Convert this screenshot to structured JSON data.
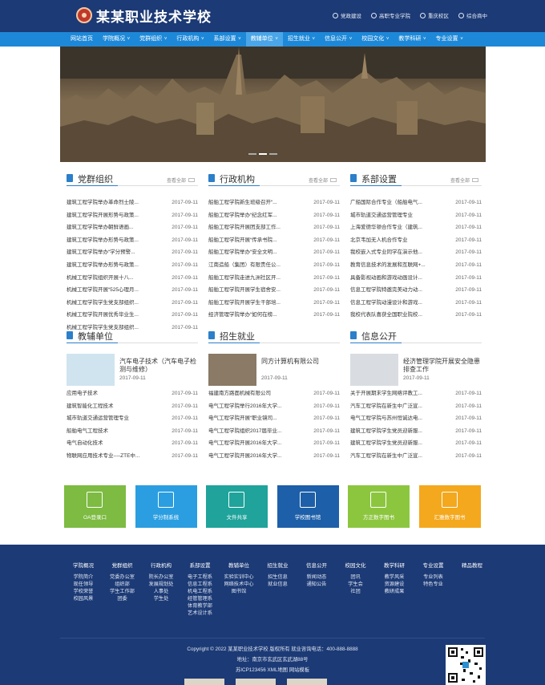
{
  "header": {
    "school_name": "某某职业技术学校",
    "quick_links": [
      "党政建设",
      "高职专业学院",
      "重庆校区",
      "综合商中"
    ]
  },
  "nav": {
    "items": [
      {
        "label": "网站首页",
        "chev": false
      },
      {
        "label": "学院概况",
        "chev": true
      },
      {
        "label": "党群组织",
        "chev": true
      },
      {
        "label": "行政机构",
        "chev": true
      },
      {
        "label": "系部设置",
        "chev": true
      },
      {
        "label": "教辅单位",
        "chev": true,
        "active": true
      },
      {
        "label": "招生就业",
        "chev": true
      },
      {
        "label": "信息公开",
        "chev": true
      },
      {
        "label": "校园文化",
        "chev": true
      },
      {
        "label": "教学科研",
        "chev": true
      },
      {
        "label": "专业设置",
        "chev": true
      }
    ]
  },
  "news_sections": [
    {
      "title": "党群组织",
      "more": "查看全部",
      "items": [
        {
          "title": "建筑工程学院举办革命烈士陵...",
          "date": "2017-09-11"
        },
        {
          "title": "建筑工程学院开展形势与政策...",
          "date": "2017-09-11"
        },
        {
          "title": "建筑工程学院举办朝鲜语画...",
          "date": "2017-09-11"
        },
        {
          "title": "建筑工程学院举办形势与政策...",
          "date": "2017-09-11"
        },
        {
          "title": "建筑工程学院举办“学分预警...",
          "date": "2017-09-11"
        },
        {
          "title": "建筑工程学院举办形势与政策...",
          "date": "2017-09-11"
        },
        {
          "title": "机械工程学院组织开展十八...",
          "date": "2017-09-11"
        },
        {
          "title": "机械工程学院开展“525心理月...",
          "date": "2017-09-11"
        },
        {
          "title": "机械工程学院学生党支部组织...",
          "date": "2017-09-11"
        },
        {
          "title": "机械工程学院开展优秀毕业生...",
          "date": "2017-09-11"
        },
        {
          "title": "机械工程学院学生党支部组织...",
          "date": "2017-09-11"
        }
      ]
    },
    {
      "title": "行政机构",
      "more": "查看全部",
      "items": [
        {
          "title": "船舶工程学院新生班级召开“...",
          "date": "2017-09-11"
        },
        {
          "title": "船舶工程学院举办“纪念红军...",
          "date": "2017-09-11"
        },
        {
          "title": "船舶工程学院开展团支部工作...",
          "date": "2017-09-11"
        },
        {
          "title": "船舶工程学院开展“传承书院...",
          "date": "2017-09-11"
        },
        {
          "title": "船舶工程学院举办“安全文明...",
          "date": "2017-09-11"
        },
        {
          "title": "江南造船（集团）有限责任公...",
          "date": "2017-09-11"
        },
        {
          "title": "船舶工程学院走进九洲社区开...",
          "date": "2017-09-11"
        },
        {
          "title": "船舶工程学院开展学生宿舍安...",
          "date": "2017-09-11"
        },
        {
          "title": "船舶工程学院开展学生干部培...",
          "date": "2017-09-11"
        },
        {
          "title": "经济管理学院举办“如何在榜...",
          "date": "2017-09-11"
        }
      ]
    },
    {
      "title": "系部设置",
      "more": "查看全部",
      "items": [
        {
          "title": "广船国际合作专业（船舶电气...",
          "date": "2017-09-11"
        },
        {
          "title": "城市轨道交通运营管理专业",
          "date": "2017-09-11"
        },
        {
          "title": "上海爱德华顿合作专业（建筑...",
          "date": "2017-09-11"
        },
        {
          "title": "北京韦加无人机合作专业",
          "date": "2017-09-11"
        },
        {
          "title": "我校嵌入式专业同学在演示他...",
          "date": "2017-09-11"
        },
        {
          "title": "教育信息技术的发展和互联网+...",
          "date": "2017-09-11"
        },
        {
          "title": "具备影视动画和游戏动画设计...",
          "date": "2017-09-11"
        },
        {
          "title": "信息工程学院特邀完美动力动...",
          "date": "2017-09-11"
        },
        {
          "title": "信息工程学院动漫设计和游戏...",
          "date": "2017-09-11"
        },
        {
          "title": "我校代表队喜获全国职业院校...",
          "date": "2017-09-11"
        }
      ]
    },
    {
      "title": "教辅单位",
      "feature": {
        "title": "汽车电子技术（汽车电子检测与维修）",
        "date": "2017-09-11"
      },
      "items": [
        {
          "title": "应用电子技术",
          "date": "2017-09-11"
        },
        {
          "title": "建筑智能化工程技术",
          "date": "2017-09-11"
        },
        {
          "title": "城市轨道交通运营管理专业",
          "date": "2017-09-11"
        },
        {
          "title": "船舶电气工程技术",
          "date": "2017-09-11"
        },
        {
          "title": "电气自动化技术",
          "date": "2017-09-11"
        },
        {
          "title": "物联网应用技术专业----ZTE中...",
          "date": "2017-09-11"
        }
      ]
    },
    {
      "title": "招生就业",
      "feature": {
        "title": "同方计算机有限公司",
        "date": "2017-09-11"
      },
      "items": [
        {
          "title": "福建南方路面机械有限公司",
          "date": "2017-09-11"
        },
        {
          "title": "电气工程学院举行2016年大学...",
          "date": "2017-09-11"
        },
        {
          "title": "电气工程学院开展“职业镜司...",
          "date": "2017-09-11"
        },
        {
          "title": "电气工程学院组织2017届毕业...",
          "date": "2017-09-11"
        },
        {
          "title": "电气工程学院开展2016年大学...",
          "date": "2017-09-11"
        },
        {
          "title": "电气工程学院开展2016年大学...",
          "date": "2017-09-11"
        }
      ]
    },
    {
      "title": "信息公开",
      "feature": {
        "title": "经济管理学院开展安全隐患排查工作",
        "date": "2017-09-11"
      },
      "items": [
        {
          "title": "关于开展期末学生网络评教工...",
          "date": "2017-09-11"
        },
        {
          "title": "汽车工程学院在新生中广泛宣...",
          "date": "2017-09-11"
        },
        {
          "title": "电气工程学院与苏州恒诚达电...",
          "date": "2017-09-11"
        },
        {
          "title": "建筑工程学院学生党员迎新服...",
          "date": "2017-09-11"
        },
        {
          "title": "建筑工程学院学生党员迎新服...",
          "date": "2017-09-11"
        },
        {
          "title": "汽车工程学院在新生中广泛宣...",
          "date": "2017-09-11"
        }
      ]
    }
  ],
  "quick_access": [
    {
      "label": "OA登录口",
      "color": "#7dbb42",
      "icon": "id-card-icon"
    },
    {
      "label": "学分制系统",
      "color": "#2a9ee0",
      "icon": "chart-icon"
    },
    {
      "label": "文件共享",
      "color": "#1fa39b",
      "icon": "document-icon"
    },
    {
      "label": "学校图书馆",
      "color": "#1d5fa8",
      "icon": "library-icon"
    },
    {
      "label": "方正数字图书",
      "color": "#8cc63f",
      "icon": "book-icon"
    },
    {
      "label": "汇雅数字图书",
      "color": "#f4a81d",
      "icon": "books-icon"
    }
  ],
  "footer": {
    "columns": [
      {
        "head": "学院概况",
        "links": [
          "学院简介",
          "现任领导",
          "学校荣誉",
          "校园风景"
        ]
      },
      {
        "head": "党群组织",
        "links": [
          "党委办公室",
          "组织部",
          "学生工作部",
          "团委"
        ]
      },
      {
        "head": "行政机构",
        "links": [
          "院长办公室",
          "发展规划处",
          "人事处",
          "学生处"
        ]
      },
      {
        "head": "系部设置",
        "links": [
          "电子工程系",
          "信息工程系",
          "机电工程系",
          "经管管理系",
          "体育教学部",
          "艺术设计系"
        ]
      },
      {
        "head": "教辅单位",
        "links": [
          "实验实训中心",
          "网络技术中心",
          "图书馆"
        ]
      },
      {
        "head": "招生就业",
        "links": [
          "招生信息",
          "就业信息"
        ]
      },
      {
        "head": "信息公开",
        "links": [
          "新闻动态",
          "通知公告"
        ]
      },
      {
        "head": "校园文化",
        "links": [
          "团讯",
          "学生会",
          "社团"
        ]
      },
      {
        "head": "教学科研",
        "links": [
          "教学风采",
          "资源建设",
          "教研成果"
        ]
      },
      {
        "head": "专业设置",
        "links": [
          "专业列表",
          "特色专业"
        ]
      },
      {
        "head": "精品教程",
        "links": []
      }
    ],
    "copyright": "Copyright © 2022 某某职业技术学校 版权所有 就业咨询电话：400-888-8888",
    "address": "地址：南京市玄武区玄武湖88号",
    "icp": "苏ICP123456 XML地图 网站模板"
  }
}
